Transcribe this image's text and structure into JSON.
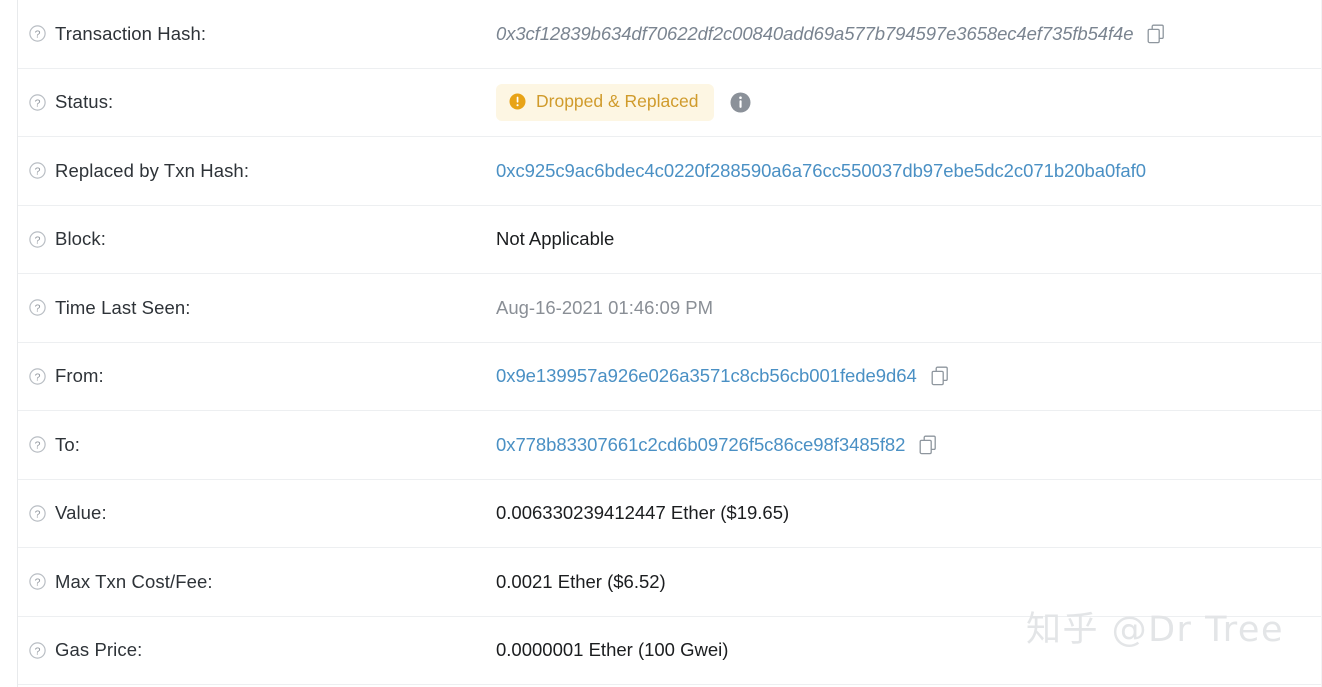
{
  "page": {
    "watermark": "知乎 @Dr Tree"
  },
  "rows": [
    {
      "label": "Transaction Hash:",
      "value": "0x3cf12839b634df70622df2c00840add69a577b794597e3658ec4ef735fb54f4e",
      "style": "hash-italic",
      "copy": true,
      "name": "transaction-hash"
    },
    {
      "label": "Status:",
      "value": "Dropped & Replaced",
      "style": "badge",
      "name": "status"
    },
    {
      "label": "Replaced by Txn Hash:",
      "value": "0xc925c9ac6bdec4c0220f288590a6a76cc550037db97ebe5dc2c071b20ba0faf0",
      "style": "link",
      "copy": false,
      "name": "replaced-by-txn-hash"
    },
    {
      "label": "Block:",
      "value": "Not Applicable",
      "style": "plain",
      "copy": false,
      "name": "block"
    },
    {
      "label": "Time Last Seen:",
      "value": "Aug-16-2021 01:46:09 PM",
      "style": "muted",
      "copy": false,
      "name": "time-last-seen"
    },
    {
      "label": "From:",
      "value": "0x9e139957a926e026a3571c8cb56cb001fede9d64",
      "style": "link",
      "copy": true,
      "name": "from-address"
    },
    {
      "label": "To:",
      "value": "0x778b83307661c2cd6b09726f5c86ce98f3485f82",
      "style": "link",
      "copy": true,
      "name": "to-address"
    },
    {
      "label": "Value:",
      "value": "0.006330239412447 Ether ($19.65)",
      "style": "plain",
      "copy": false,
      "name": "value"
    },
    {
      "label": "Max Txn Cost/Fee:",
      "value": "0.0021 Ether ($6.52)",
      "style": "plain",
      "copy": false,
      "name": "max-txn-cost-fee"
    },
    {
      "label": "Gas Price:",
      "value": "0.0000001 Ether (100 Gwei)",
      "style": "plain",
      "copy": false,
      "name": "gas-price"
    }
  ],
  "colors": {
    "link": "#4a90c4",
    "status_text": "#d09b2c",
    "status_bg": "#fdf6e3",
    "muted": "#8a8f96",
    "text": "#1b1d1f"
  },
  "icons": {
    "help": "question-circle-icon",
    "copy": "copy-icon",
    "status_alert": "exclamation-circle-icon",
    "info": "info-circle-icon"
  }
}
